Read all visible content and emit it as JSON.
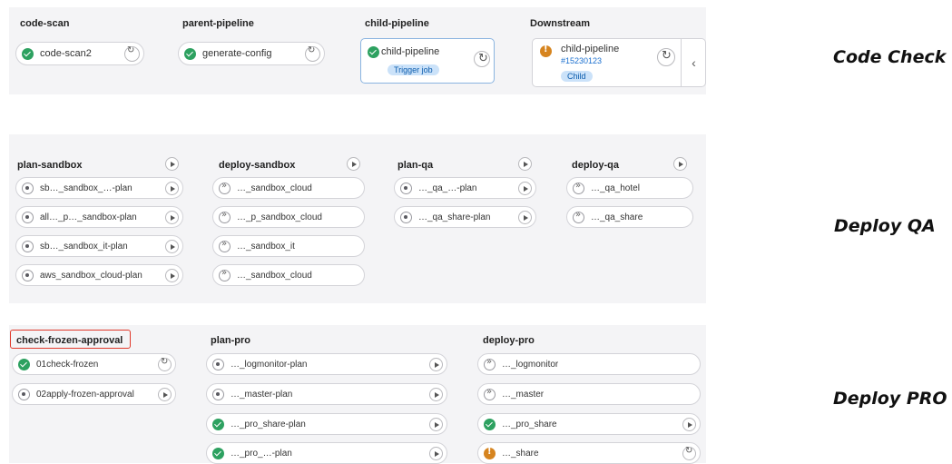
{
  "section1": {
    "side_label": "Code Check",
    "stages": [
      {
        "title": "code-scan",
        "job": {
          "name": "code-scan2",
          "status": "success",
          "action": "retry"
        }
      },
      {
        "title": "parent-pipeline",
        "job": {
          "name": "generate-config",
          "status": "success",
          "action": "retry"
        }
      },
      {
        "title": "child-pipeline",
        "job": {
          "name": "child-pipeline",
          "status": "success",
          "action": "retry",
          "badge": "Trigger job"
        }
      },
      {
        "title": "Downstream",
        "job": {
          "name": "child-pipeline",
          "status": "warning",
          "action": "retry",
          "link": "#15230123",
          "badge": "Child"
        }
      }
    ],
    "collapse_icon": "chevron-left-icon"
  },
  "section2": {
    "side_label": "Deploy QA",
    "stages": [
      {
        "title": "plan-sandbox",
        "jobs": [
          {
            "name": "sb…_sandbox_…-plan",
            "status": "created",
            "action": "play"
          },
          {
            "name": "all…_p…_sandbox-plan",
            "status": "created",
            "action": "play"
          },
          {
            "name": "sb…_sandbox_it-plan",
            "status": "created",
            "action": "play"
          },
          {
            "name": "aws_sandbox_cloud-plan",
            "status": "created",
            "action": "play"
          }
        ]
      },
      {
        "title": "deploy-sandbox",
        "jobs": [
          {
            "name": "…_sandbox_cloud",
            "status": "manual"
          },
          {
            "name": "…_p_sandbox_cloud",
            "status": "manual"
          },
          {
            "name": "…_sandbox_it",
            "status": "manual"
          },
          {
            "name": "…_sandbox_cloud",
            "status": "manual"
          }
        ]
      },
      {
        "title": "plan-qa",
        "jobs": [
          {
            "name": "…_qa_…-plan",
            "status": "created",
            "action": "play"
          },
          {
            "name": "…_qa_share-plan",
            "status": "created",
            "action": "play"
          }
        ]
      },
      {
        "title": "deploy-qa",
        "jobs": [
          {
            "name": "…_qa_hotel",
            "status": "manual"
          },
          {
            "name": "…_qa_share",
            "status": "manual"
          }
        ]
      }
    ]
  },
  "section3": {
    "side_label": "Deploy PRO",
    "stages": [
      {
        "title": "check-frozen-approval",
        "highlighted": true,
        "jobs": [
          {
            "name": "01check-frozen",
            "status": "success",
            "action": "retry"
          },
          {
            "name": "02apply-frozen-approval",
            "status": "created",
            "action": "play"
          }
        ]
      },
      {
        "title": "plan-pro",
        "jobs": [
          {
            "name": "…_logmonitor-plan",
            "status": "created",
            "action": "play"
          },
          {
            "name": "…_master-plan",
            "status": "created",
            "action": "play"
          },
          {
            "name": "…_pro_share-plan",
            "status": "success",
            "action": "play"
          },
          {
            "name": "…_pro_…-plan",
            "status": "success",
            "action": "play"
          }
        ]
      },
      {
        "title": "deploy-pro",
        "jobs": [
          {
            "name": "…_logmonitor",
            "status": "manual"
          },
          {
            "name": "…_master",
            "status": "manual"
          },
          {
            "name": "…_pro_share",
            "status": "success",
            "action": "play"
          },
          {
            "name": "…_share",
            "status": "warning",
            "action": "retry"
          }
        ]
      }
    ]
  }
}
